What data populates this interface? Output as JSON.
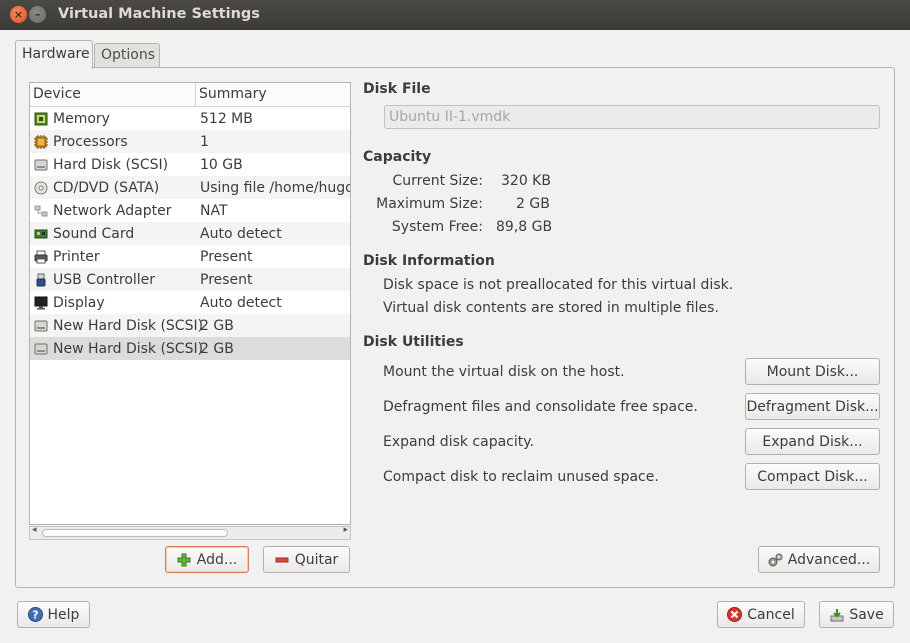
{
  "window": {
    "title": "Virtual Machine Settings",
    "close_glyph": "×",
    "min_glyph": "–"
  },
  "tabs": [
    {
      "label": "Hardware"
    },
    {
      "label": "Options"
    }
  ],
  "device_list": {
    "columns": [
      "Device",
      "Summary"
    ],
    "rows": [
      {
        "icon": "memory-icon",
        "device": "Memory",
        "summary": "512 MB"
      },
      {
        "icon": "processor-icon",
        "device": "Processors",
        "summary": "1"
      },
      {
        "icon": "hard-disk-icon",
        "device": "Hard Disk (SCSI)",
        "summary": "10 GB"
      },
      {
        "icon": "cd-dvd-icon",
        "device": "CD/DVD (SATA)",
        "summary": "Using file /home/hugo/"
      },
      {
        "icon": "network-icon",
        "device": "Network Adapter",
        "summary": "NAT"
      },
      {
        "icon": "sound-card-icon",
        "device": "Sound Card",
        "summary": "Auto detect"
      },
      {
        "icon": "printer-icon",
        "device": "Printer",
        "summary": "Present"
      },
      {
        "icon": "usb-icon",
        "device": "USB Controller",
        "summary": "Present"
      },
      {
        "icon": "display-icon",
        "device": "Display",
        "summary": "Auto detect"
      },
      {
        "icon": "hard-disk-icon",
        "device": "New Hard Disk (SCSI)",
        "summary": "2 GB"
      },
      {
        "icon": "hard-disk-icon",
        "device": "New Hard Disk (SCSI)",
        "summary": "2 GB"
      }
    ],
    "selected_index": 10
  },
  "list_buttons": {
    "add": "Add...",
    "remove": "Quitar"
  },
  "disk_file": {
    "heading": "Disk File",
    "value": "Ubuntu II-1.vmdk"
  },
  "capacity": {
    "heading": "Capacity",
    "current_label": "Current Size:",
    "current_value": "320 KB",
    "max_label": "Maximum Size:",
    "max_value": "2 GB",
    "free_label": "System Free:",
    "free_value": "89,8 GB"
  },
  "disk_info": {
    "heading": "Disk Information",
    "line1": "Disk space is not preallocated for this virtual disk.",
    "line2": "Virtual disk contents are stored in multiple files."
  },
  "utilities": {
    "heading": "Disk Utilities",
    "mount_text": "Mount the virtual disk on the host.",
    "mount_btn": "Mount Disk...",
    "defrag_text": "Defragment files and consolidate free space.",
    "defrag_btn": "Defragment Disk...",
    "expand_text": "Expand disk capacity.",
    "expand_btn": "Expand Disk...",
    "compact_text": "Compact disk to reclaim unused space.",
    "compact_btn": "Compact Disk..."
  },
  "advanced_btn": "Advanced...",
  "footer": {
    "help": "Help",
    "cancel": "Cancel",
    "save": "Save"
  },
  "colors": {
    "titlebar": "#3c3b37",
    "close": "#e0521f",
    "window_bg": "#f2f1f0",
    "focus_border": "#e0795a"
  }
}
